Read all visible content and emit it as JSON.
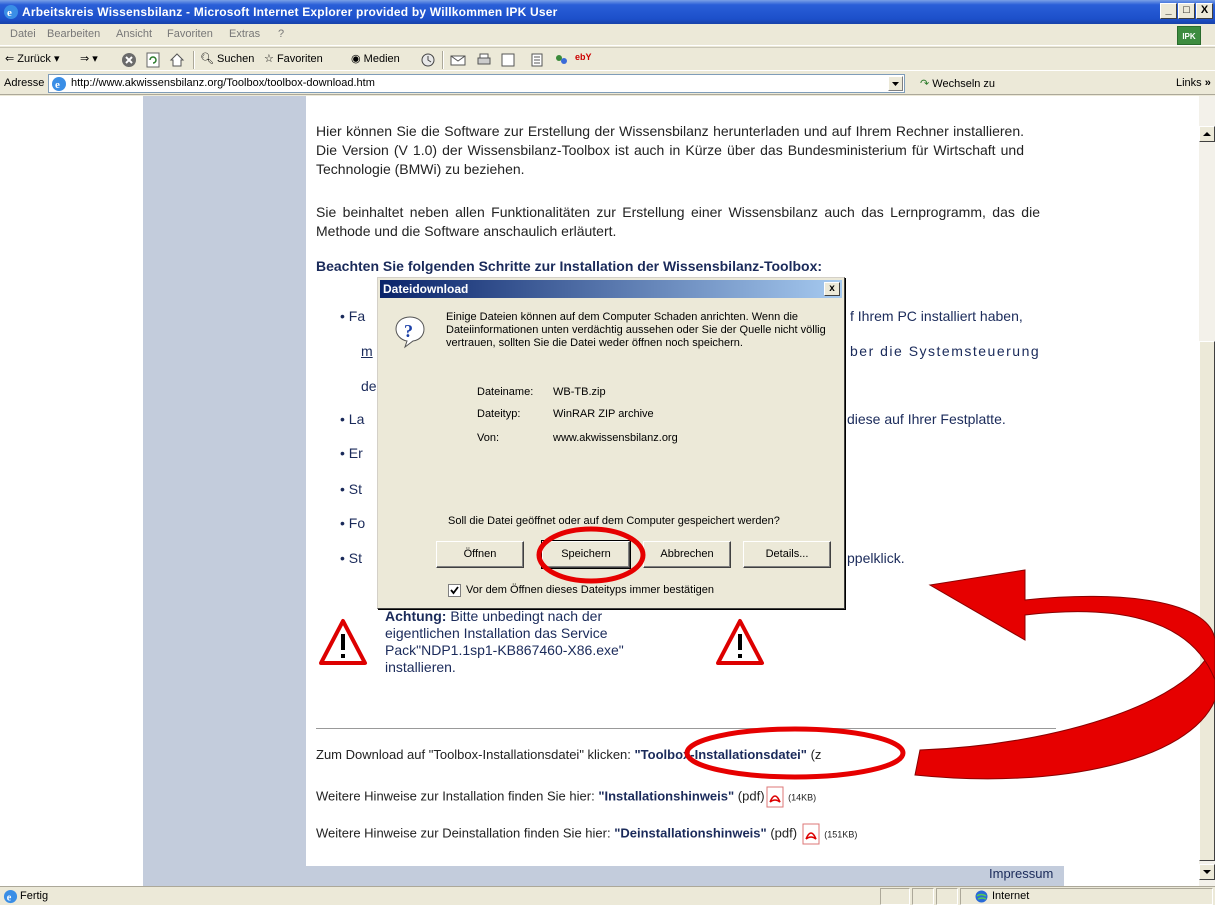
{
  "window": {
    "title": "Arbeitskreis Wissensbilanz - Microsoft Internet Explorer provided by Willkommen IPK User",
    "minimize": "_",
    "maximize": "□",
    "close": "X"
  },
  "menu": {
    "items": [
      "Datei",
      "Bearbeiten",
      "Ansicht",
      "Favoriten",
      "Extras",
      "?"
    ],
    "logo": "IPK"
  },
  "toolbar": {
    "back": "Zurück",
    "search": "Suchen",
    "favorites": "Favoriten",
    "media": "Medien"
  },
  "address": {
    "label": "Adresse",
    "url": "http://www.akwissensbilanz.org/Toolbox/toolbox-download.htm",
    "go": "Wechseln zu",
    "links": "Links"
  },
  "content": {
    "para1": "Hier können Sie die Software zur Erstellung der Wissensbilanz herunterladen und auf Ihrem Rechner installieren. Die Version (V 1.0) der Wissensbilanz-Toolbox ist auch in Kürze über das Bundesministerium für Wirtschaft und Technologie (BMWi) zu beziehen.",
    "para2": "Sie beinhaltet neben allen Funktionalitäten zur Erstellung einer Wissensbilanz auch das Lernprogramm, das die Methode und die Software anschaulich erläutert.",
    "heading": "Beachten Sie folgenden Schritte zur Installation der Wissensbilanz-Toolbox:",
    "bullets": [
      {
        "left": "Fa",
        "right": "f Ihrem PC installiert haben,"
      },
      {
        "left": "m",
        "right": "ber die Systemsteuerung"
      },
      {
        "left": "de",
        "right": ""
      },
      {
        "left": "La",
        "right": "diese auf Ihrer Festplatte."
      },
      {
        "left": "Er",
        "right": ""
      },
      {
        "left": "St",
        "right": ""
      },
      {
        "left": "Fo",
        "right": ""
      },
      {
        "left": "St",
        "right": "ppelklick."
      }
    ],
    "warning_bold": "Achtung:",
    "warning_lines": [
      "Bitte unbedingt nach der",
      "eigentlichen Installation das Service",
      "Pack\"NDP1.1sp1-KB867460-X86.exe\"",
      "installieren."
    ],
    "download_line_prefix": "Zum Download auf \"Toolbox-Installationsdatei\" klicken:",
    "download_link": "\"Toolbox-Installationsdatei\"",
    "download_suffix": "(z",
    "install_prefix": "Weitere Hinweise zur Installation finden Sie hier:",
    "install_link": "\"Installationshinweis\"",
    "install_type": "(pdf)",
    "install_size": "(14KB)",
    "uninstall_prefix": "Weitere Hinweise zur Deinstallation finden Sie hier:",
    "uninstall_link": "\"Deinstallationshinweis\"",
    "uninstall_type": "(pdf)",
    "uninstall_size": "(151KB)",
    "impressum": "Impressum"
  },
  "dialog": {
    "title": "Dateidownload",
    "close": "x",
    "message": "Einige Dateien können auf dem Computer Schaden anrichten. Wenn die Dateiinformationen unten verdächtig aussehen oder Sie der Quelle nicht völlig vertrauen, sollten Sie die Datei weder öffnen noch speichern.",
    "file_name_label": "Dateiname:",
    "file_name": "WB-TB.zip",
    "file_type_label": "Dateityp:",
    "file_type": "WinRAR ZIP archive",
    "from_label": "Von:",
    "from": "www.akwissensbilanz.org",
    "question": "Soll die Datei geöffnet oder auf dem Computer gespeichert werden?",
    "buttons": {
      "open": "Öffnen",
      "save": "Speichern",
      "cancel": "Abbrechen",
      "details": "Details..."
    },
    "checkbox_label": "Vor dem Öffnen dieses Dateityps immer bestätigen",
    "checkbox_checked": true
  },
  "status": {
    "text": "Fertig",
    "zone": "Internet"
  },
  "colors": {
    "sidebar": "#c3ccdc",
    "link_text": "#1a2a5a",
    "annotation_red": "#e60000"
  }
}
